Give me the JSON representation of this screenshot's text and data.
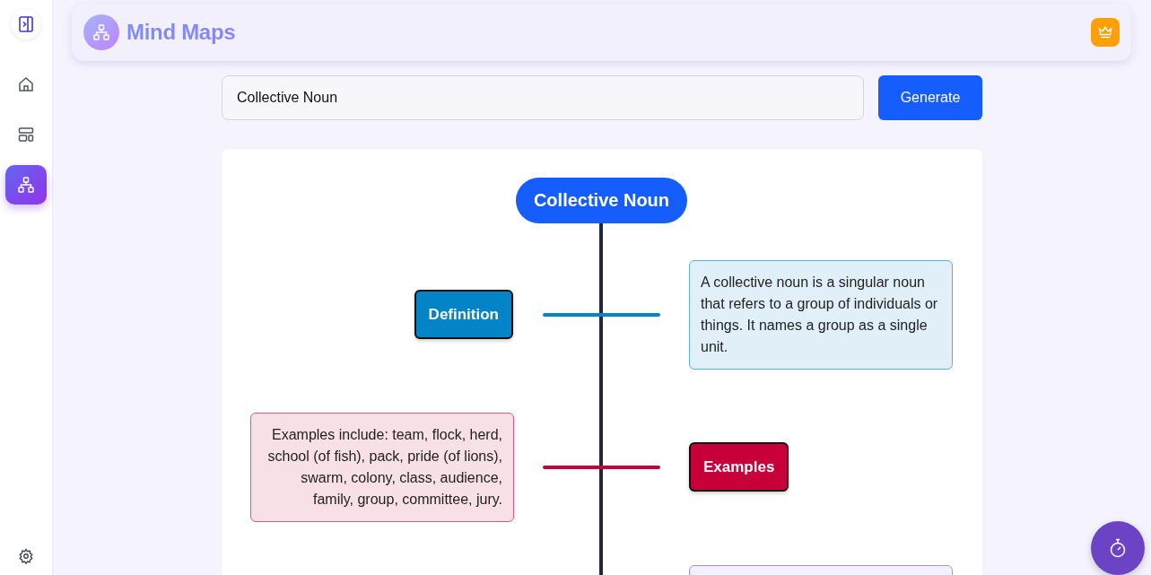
{
  "app": {
    "title": "Mind Maps"
  },
  "sidebar": {
    "items": [
      {
        "kind": "home",
        "selected": false
      },
      {
        "kind": "layout",
        "selected": false
      },
      {
        "kind": "mindmap",
        "selected": true
      }
    ]
  },
  "topic": {
    "value": "Collective Noun",
    "button": "Generate"
  },
  "mind_map": {
    "root": "Collective Noun",
    "branches": [
      {
        "kind": "left",
        "label": "Definition",
        "color": "#0284c7",
        "description": "A collective noun is a singular noun that refers to a group of individuals or things. It names a group as a single unit."
      },
      {
        "kind": "right",
        "label": "Examples",
        "color": "#c8003a",
        "description": "Examples include: team, flock, herd, school (of fish), pack, pride (of lions), swarm, colony, class, audience, family, group, committee, jury."
      },
      {
        "kind": "left",
        "color": "#a78bfa"
      }
    ]
  }
}
